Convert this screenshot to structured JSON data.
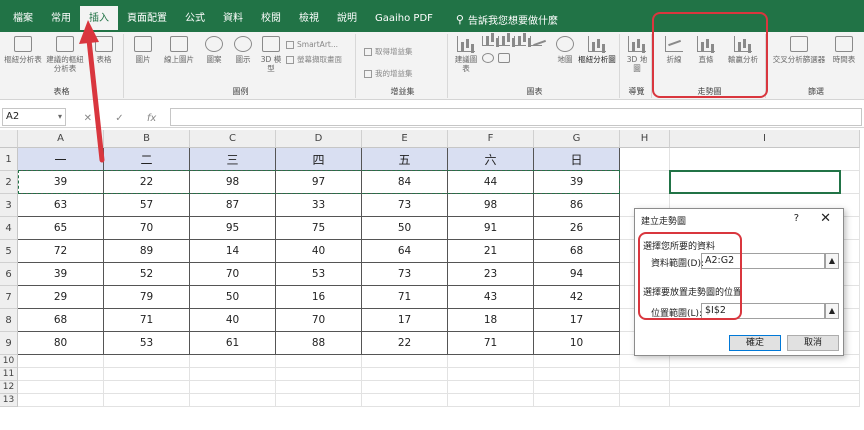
{
  "tabs": [
    "檔案",
    "常用",
    "插入",
    "頁面配置",
    "公式",
    "資料",
    "校閱",
    "檢視",
    "說明",
    "Gaaiho PDF"
  ],
  "tell_me": "告訴我您想要做什麼",
  "ribbon": {
    "groups": {
      "tables": "表格",
      "illustrations": "圖例",
      "addins": "增益集",
      "charts": "圖表",
      "tours": "導覽",
      "sparklines": "走勢圖",
      "filters": "篩選"
    },
    "buttons": {
      "pivot": "樞紐分析表",
      "rec_pivot": "建議的樞紐分析表",
      "table": "表格",
      "pictures": "圖片",
      "online_pictures": "線上圖片",
      "shapes": "圖案",
      "icons": "圖示",
      "models_3d": "3D 模型",
      "smartart": "SmartArt...",
      "screenshot": "螢幕擷取畫面",
      "get_addins": "取得增益集",
      "my_addins": "我的增益集",
      "rec_charts": "建議圖表",
      "maps": "地圖",
      "pivot_chart": "樞紐分析圖",
      "map_3d": "3D 地圖",
      "line": "折線",
      "column": "直條",
      "winloss": "輸贏分析",
      "slicer": "交叉分析篩選器",
      "timeline": "時間表"
    }
  },
  "formula_bar": {
    "name_box": "A2",
    "fx": "fx",
    "cancel": "✕",
    "confirm": "✓"
  },
  "columns": [
    "A",
    "B",
    "C",
    "D",
    "E",
    "F",
    "G",
    "H",
    "I"
  ],
  "rows": [
    "1",
    "2",
    "3",
    "4",
    "5",
    "6",
    "7",
    "8",
    "9",
    "10",
    "11",
    "12",
    "13"
  ],
  "headers": [
    "一",
    "二",
    "三",
    "四",
    "五",
    "六",
    "日"
  ],
  "table": [
    [
      39,
      22,
      98,
      97,
      84,
      44,
      39
    ],
    [
      63,
      57,
      87,
      33,
      73,
      98,
      86
    ],
    [
      65,
      70,
      95,
      75,
      50,
      91,
      26
    ],
    [
      72,
      89,
      14,
      40,
      64,
      21,
      68
    ],
    [
      39,
      52,
      70,
      53,
      73,
      23,
      94
    ],
    [
      29,
      79,
      50,
      16,
      71,
      43,
      42
    ],
    [
      68,
      71,
      40,
      70,
      17,
      18,
      17
    ],
    [
      80,
      53,
      61,
      88,
      22,
      71,
      10
    ]
  ],
  "dialog": {
    "title": "建立走勢圖",
    "help": "?",
    "close": "✕",
    "section_data": "選擇您所要的資料",
    "data_range_label": "資料範圍(D):",
    "data_range_value": "A2:G2",
    "section_location": "選擇要放置走勢圖的位置",
    "location_label": "位置範圍(L):",
    "location_value": "$I$2",
    "ok": "確定",
    "cancel": "取消"
  },
  "colors": {
    "excel_green": "#217346",
    "header_fill": "#d9dff2",
    "annotation_red": "#d9363e"
  }
}
